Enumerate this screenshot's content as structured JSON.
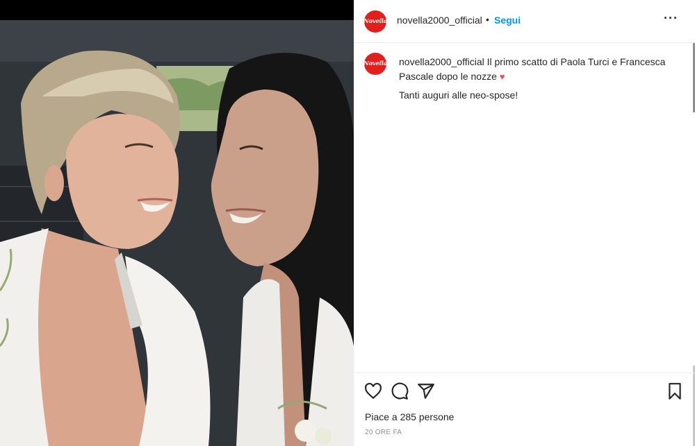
{
  "photo": {
    "description_icon": "wedding-photo"
  },
  "header": {
    "avatar_text": "Novella",
    "username": "novella2000_official",
    "separator": "•",
    "follow_label": "Segui",
    "more_label": "···"
  },
  "caption": {
    "avatar_text": "Novella",
    "username": "novella2000_official",
    "text": "Il primo scatto di Paola Turci e Francesca Pascale dopo le nozze",
    "emoji": "♥",
    "second_line": "Tanti auguri alle neo-spose!"
  },
  "actions": {
    "like_icon": "heart-icon",
    "comment_icon": "comment-icon",
    "share_icon": "share-icon",
    "save_icon": "bookmark-icon"
  },
  "likes_text": "Piace a 285 persone",
  "timestamp": "20 ORE FA",
  "colors": {
    "brand": "#e0201c",
    "follow": "#0095f6",
    "heart": "#ed4956"
  }
}
